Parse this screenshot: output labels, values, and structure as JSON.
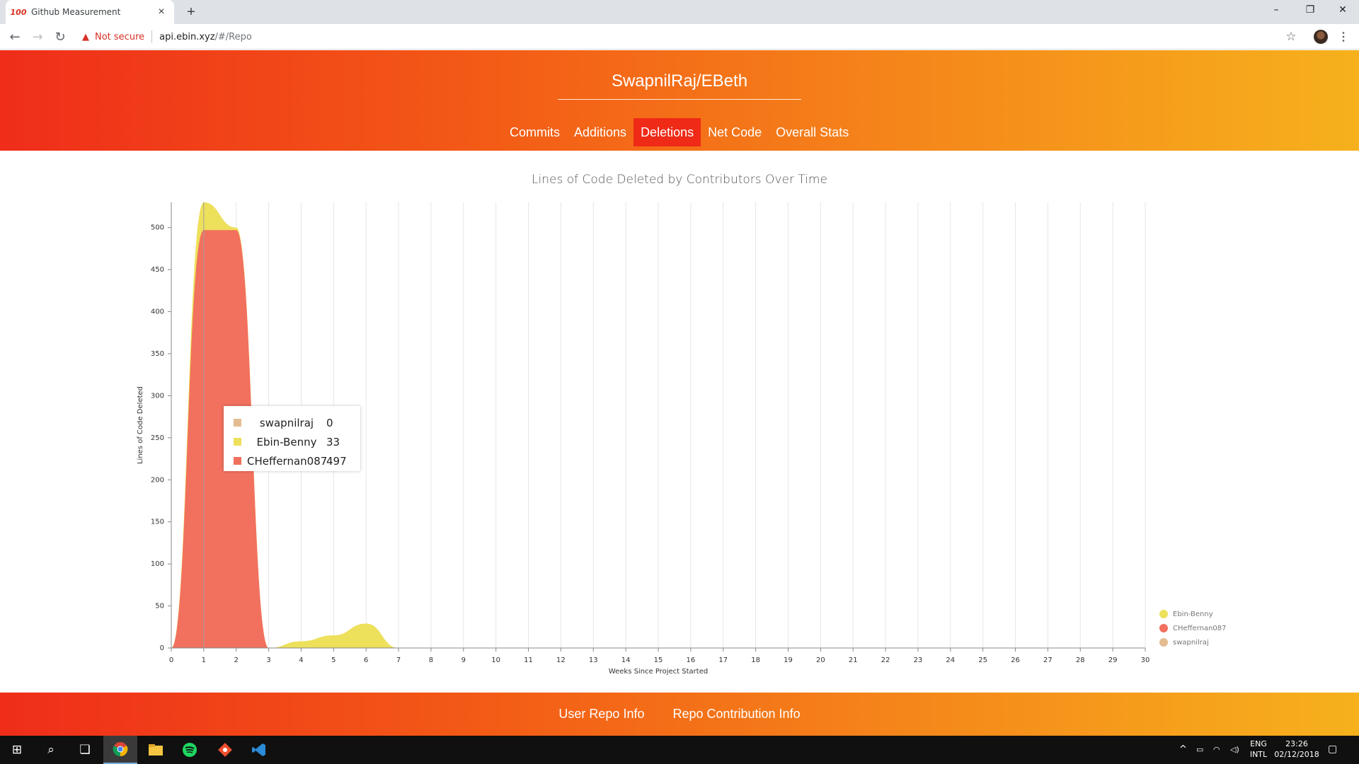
{
  "browser": {
    "tab_title": "Github Measurement",
    "tab_favicon": "100",
    "security_label": "Not secure",
    "url_host": "api.ebin.xyz",
    "url_path": "/#/Repo"
  },
  "header": {
    "repo_name": "SwapnilRaj/EBeth",
    "nav": [
      {
        "label": "Commits",
        "active": false
      },
      {
        "label": "Additions",
        "active": false
      },
      {
        "label": "Deletions",
        "active": true
      },
      {
        "label": "Net Code",
        "active": false
      },
      {
        "label": "Overall Stats",
        "active": false
      }
    ]
  },
  "chart_data": {
    "type": "area",
    "title": "Lines of Code Deleted by Contributors Over Time",
    "xlabel": "Weeks Since Project Started",
    "ylabel": "Lines of Code Deleted",
    "xlim": [
      0,
      30
    ],
    "ylim": [
      0,
      530
    ],
    "yticks": [
      0,
      50,
      100,
      150,
      200,
      250,
      300,
      350,
      400,
      450,
      500
    ],
    "x": [
      0,
      1,
      2,
      3,
      4,
      5,
      6,
      7,
      8,
      9,
      10,
      11,
      12,
      13,
      14,
      15,
      16,
      17,
      18,
      19,
      20,
      21,
      22,
      23,
      24,
      25,
      26,
      27,
      28,
      29,
      30
    ],
    "stacked": true,
    "grid": true,
    "legend_position": "bottom-right",
    "series": [
      {
        "name": "swapnilraj",
        "color": "#e4bc92",
        "values": [
          0,
          0,
          0,
          0,
          0,
          0,
          0,
          0,
          0,
          0,
          0,
          0,
          0,
          0,
          0,
          0,
          0,
          0,
          0,
          0,
          0,
          0,
          0,
          0,
          0,
          0,
          0,
          0,
          0,
          0,
          0
        ]
      },
      {
        "name": "CHeffernan087",
        "color": "#f2705e",
        "values": [
          0,
          497,
          497,
          0,
          0,
          0,
          0,
          0,
          0,
          0,
          0,
          0,
          0,
          0,
          0,
          0,
          0,
          0,
          0,
          0,
          0,
          0,
          0,
          0,
          0,
          0,
          0,
          0,
          0,
          0,
          0
        ]
      },
      {
        "name": "Ebin-Benny",
        "color": "#ede05b",
        "values": [
          0,
          33,
          3,
          0,
          8,
          15,
          29,
          0,
          0,
          0,
          0,
          0,
          0,
          0,
          0,
          0,
          0,
          0,
          0,
          0,
          0,
          0,
          0,
          0,
          0,
          0,
          0,
          0,
          0,
          0,
          0
        ]
      }
    ],
    "legend_order": [
      "Ebin-Benny",
      "CHeffernan087",
      "swapnilraj"
    ],
    "tooltip": {
      "x": 1,
      "rows": [
        {
          "name": "swapnilraj",
          "value": "0",
          "color": "#e4bc92"
        },
        {
          "name": "Ebin-Benny",
          "value": "33",
          "color": "#ede05b"
        },
        {
          "name": "CHeffernan087",
          "value": "497",
          "color": "#f2705e"
        }
      ]
    }
  },
  "footer": {
    "links": [
      "User Repo Info",
      "Repo Contribution Info"
    ]
  },
  "taskbar": {
    "lang_top": "ENG",
    "lang_bottom": "INTL",
    "time": "23:26",
    "date": "02/12/2018"
  }
}
